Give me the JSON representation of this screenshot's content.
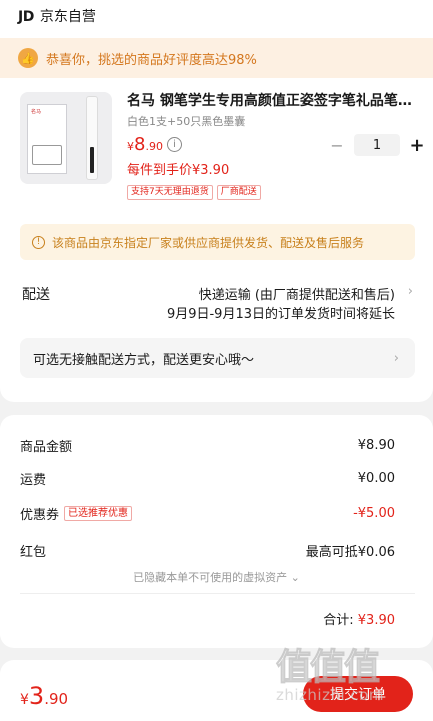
{
  "header": {
    "store_logo": "JD",
    "store_name": "京东自营"
  },
  "banner": {
    "icon": "thumbs-up-icon",
    "text": "恭喜你，挑选的商品好评度高达98%"
  },
  "product": {
    "image_brand": "名马",
    "title": "名马 钢笔学生专用高颜值正姿签字笔礼品笔…",
    "spec": "白色1支+50只黑色墨囊",
    "price_currency": "¥",
    "price_integer": "8",
    "price_decimal": ".90",
    "per_unit_price": "每件到手价¥3.90",
    "tags": [
      "支持7天无理由退货",
      "厂商配送"
    ],
    "quantity": "1",
    "minus": "−",
    "plus": "+"
  },
  "notice": {
    "text": "该商品由京东指定厂家或供应商提供发货、配送及售后服务"
  },
  "delivery": {
    "label": "配送",
    "method": "快递运输 (由厂商提供配送和售后)",
    "dates": "9月9日-9月13日的订单发货时间将延长",
    "contactless": "可选无接触配送方式，配送更安心哦～"
  },
  "summary": {
    "goods_amount_label": "商品金额",
    "goods_amount": "¥8.90",
    "shipping_label": "运费",
    "shipping": "¥0.00",
    "coupon_label": "优惠券",
    "coupon_tag": "已选推荐优惠",
    "coupon_value": "-¥5.00",
    "redpacket_label": "红包",
    "redpacket_value": "最高可抵¥0.06",
    "hidden_note": "已隐藏本单不可使用的虚拟资产 ⌄",
    "total_label": "合计: ",
    "total_value": "¥3.90"
  },
  "bottom_bar": {
    "price_currency": "¥",
    "price_integer": "3",
    "price_decimal": ".90",
    "submit_label": "提交订单"
  },
  "watermark": {
    "logo": "值值值",
    "url": "zhizhizhi.com"
  },
  "colors": {
    "accent_red": "#e2231a",
    "banner_orange": "#d4771e",
    "notice_bg": "#fdf3e2"
  }
}
